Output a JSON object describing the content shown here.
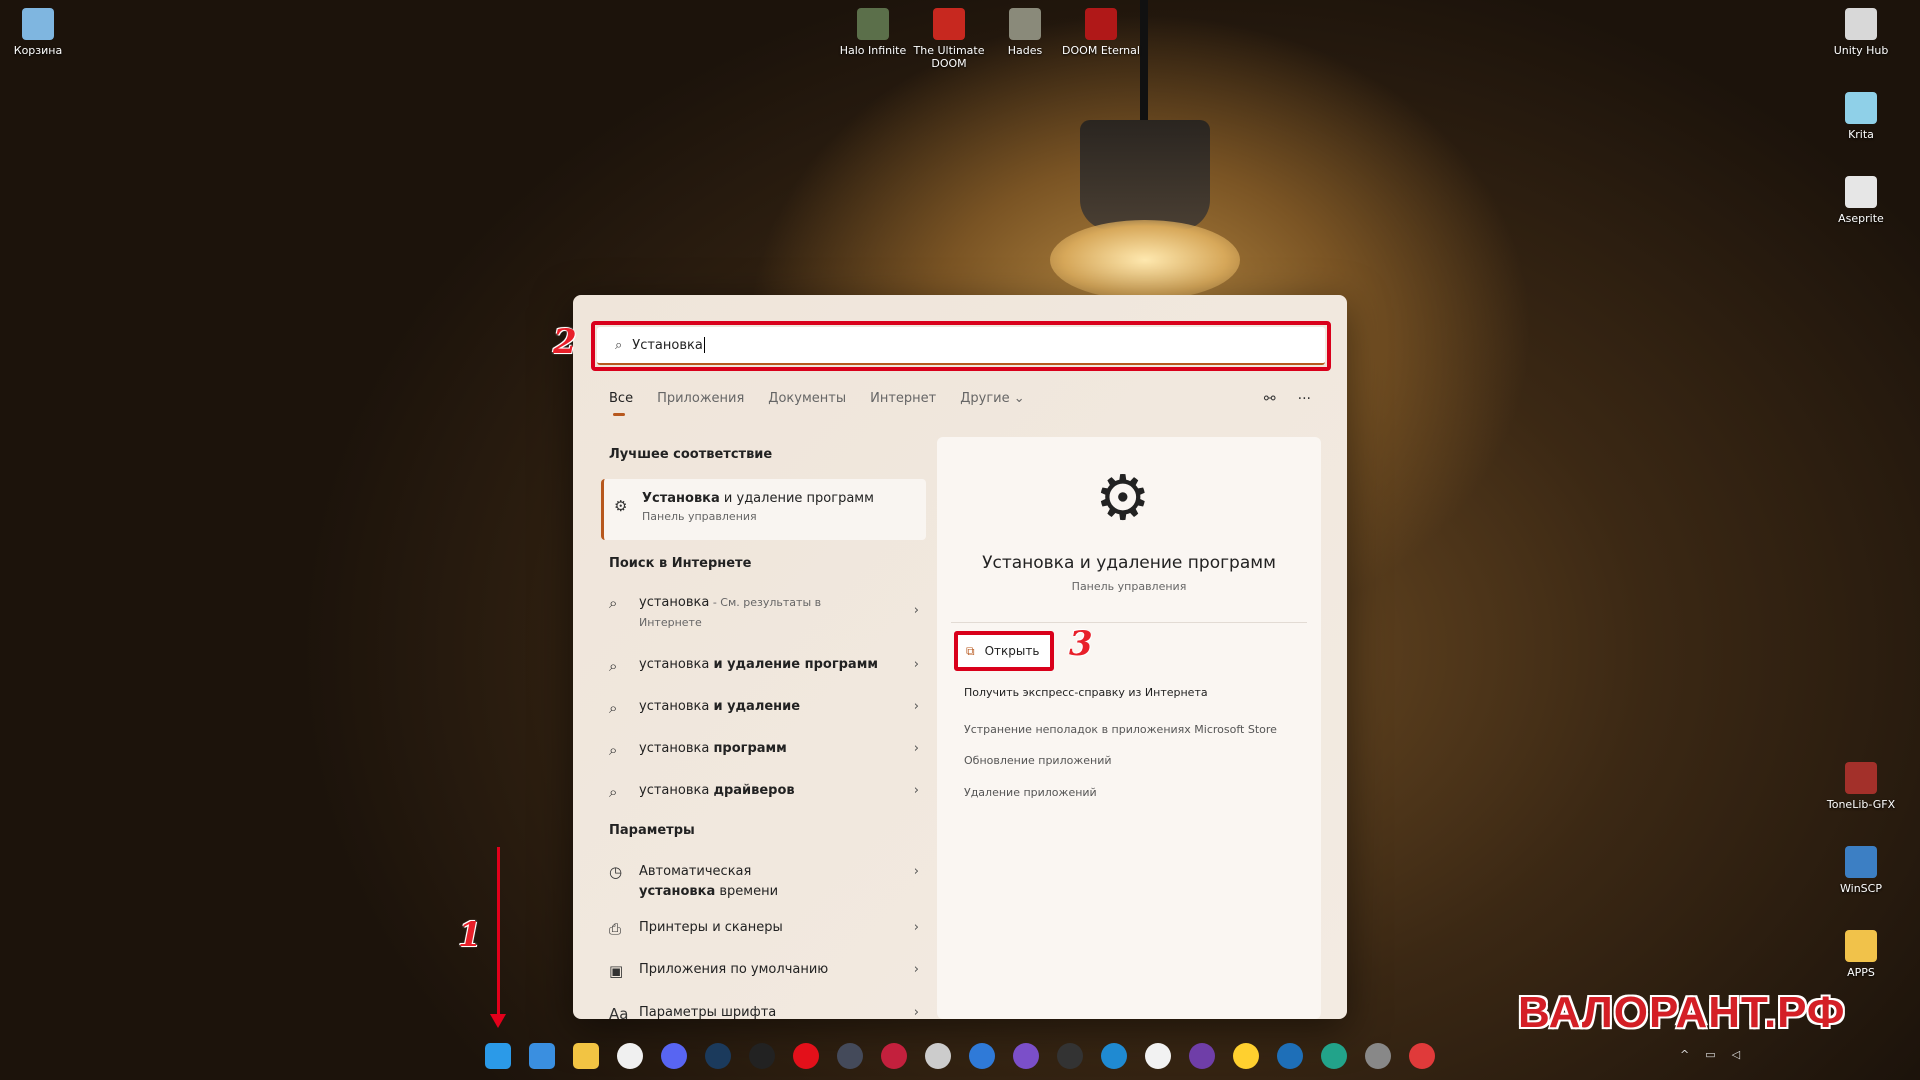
{
  "desktop": {
    "left": [
      {
        "label": "Корзина",
        "color": "#7fb6e0"
      }
    ],
    "top": [
      {
        "label": "Halo Infinite",
        "color": "#5b6f4a"
      },
      {
        "label": "The Ultimate DOOM",
        "color": "#c7281f"
      },
      {
        "label": "Hades",
        "color": "#8a8a7a"
      },
      {
        "label": "DOOM Eternal",
        "color": "#b01818"
      }
    ],
    "right": [
      {
        "label": "Unity Hub",
        "color": "#d8d8d8"
      },
      {
        "label": "Krita",
        "color": "#8fd0e8"
      },
      {
        "label": "Aseprite",
        "color": "#e6e6e6"
      },
      {
        "label": "ToneLib-GFX",
        "color": "#a3302a"
      },
      {
        "label": "WinSCP",
        "color": "#3c7fc4"
      },
      {
        "label": "APPS",
        "color": "#f1c24a"
      }
    ]
  },
  "search": {
    "value": "Установка",
    "outline_color": "#d9001b"
  },
  "tabs": [
    {
      "label": "Все",
      "active": true
    },
    {
      "label": "Приложения"
    },
    {
      "label": "Документы"
    },
    {
      "label": "Интернет"
    },
    {
      "label": "Другие ⌄"
    }
  ],
  "toolbar": {
    "share_icon": "account-link-icon",
    "more": "···"
  },
  "best_match": {
    "heading": "Лучшее соответствие",
    "title_bold": "Установка",
    "title_rest": " и удаление программ",
    "subtitle": "Панель управления"
  },
  "web": {
    "heading": "Поиск в Интернете",
    "items": [
      {
        "normal": "установка",
        "bold": "",
        "muted": " - См. результаты в Интернете"
      },
      {
        "normal": "установка ",
        "bold": "и удаление программ"
      },
      {
        "normal": "установка ",
        "bold": "и удаление"
      },
      {
        "normal": "установка ",
        "bold": "программ"
      },
      {
        "normal": "установка ",
        "bold": "драйверов"
      }
    ]
  },
  "settings": {
    "heading": "Параметры",
    "items": [
      {
        "normal": "Автоматическая ",
        "bold": "установка",
        "rest": " времени",
        "icon": "clock-settings-icon"
      },
      {
        "normal": "Принтеры и сканеры",
        "bold": "",
        "icon": "printer-icon"
      },
      {
        "normal": "Приложения по умолчанию",
        "bold": "",
        "icon": "default-apps-icon"
      },
      {
        "normal": "Параметры шрифта",
        "bold": "",
        "icon": "font-icon"
      }
    ]
  },
  "detail": {
    "title": "Установка и удаление программ",
    "subtitle": "Панель управления",
    "open": "Открыть",
    "links": [
      "Получить экспресс-справку из Интернета",
      "Устранение неполадок в приложениях Microsoft Store",
      "Обновление приложений",
      "Удаление приложений"
    ]
  },
  "annotations": {
    "one": "1",
    "two": "2",
    "three": "3"
  },
  "watermark": "ВАЛОРАНТ.РФ",
  "taskbar": [
    {
      "name": "start",
      "color": "#2b9ae8"
    },
    {
      "name": "widgets",
      "color": "#3a8fe0"
    },
    {
      "name": "file-explorer",
      "color": "#f2c443"
    },
    {
      "name": "yandex-browser",
      "color": "#f0f0f0"
    },
    {
      "name": "discord",
      "color": "#5865f2"
    },
    {
      "name": "steam",
      "color": "#1b3a5c"
    },
    {
      "name": "epic-games",
      "color": "#222"
    },
    {
      "name": "youtube-music",
      "color": "#e3101a"
    },
    {
      "name": "game",
      "color": "#444a5a"
    },
    {
      "name": "rider",
      "color": "#c3203d"
    },
    {
      "name": "unity",
      "color": "#ccc"
    },
    {
      "name": "todo",
      "color": "#2f7ad8"
    },
    {
      "name": "visual-studio",
      "color": "#7b4fc9"
    },
    {
      "name": "obs",
      "color": "#333"
    },
    {
      "name": "vscode",
      "color": "#1f8ad2"
    },
    {
      "name": "twitch-like",
      "color": "#f2f2f2"
    },
    {
      "name": "github-desktop",
      "color": "#6f3ea8"
    },
    {
      "name": "miro",
      "color": "#ffd02f"
    },
    {
      "name": "trello",
      "color": "#1e6fb8"
    },
    {
      "name": "pycharm",
      "color": "#22a38a"
    },
    {
      "name": "gimp",
      "color": "#888"
    },
    {
      "name": "opera",
      "color": "#e03a3a"
    }
  ]
}
